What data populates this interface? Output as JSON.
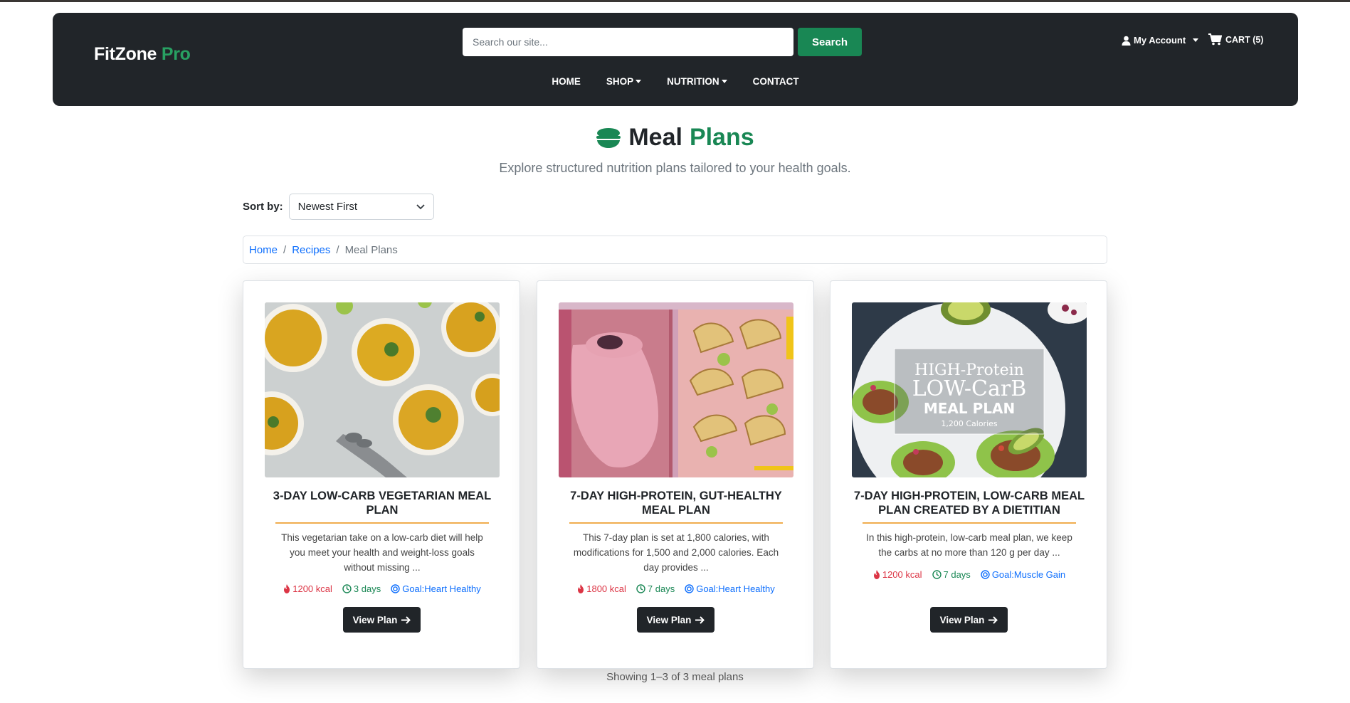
{
  "navbar": {
    "brand_main": "FitZone",
    "brand_accent": "Pro",
    "search_placeholder": "Search our site...",
    "search_button": "Search",
    "account_label": "My Account",
    "cart_label": "CART (5)",
    "menu": [
      {
        "label": "HOME",
        "dropdown": false
      },
      {
        "label": "SHOP",
        "dropdown": true
      },
      {
        "label": "NUTRITION",
        "dropdown": true
      },
      {
        "label": "CONTACT",
        "dropdown": false
      }
    ]
  },
  "header": {
    "icon": "bowl-icon",
    "title_main": "Meal",
    "title_accent": "Plans",
    "subtitle": "Explore structured nutrition plans tailored to your health goals."
  },
  "sort": {
    "label": "Sort by:",
    "selected": "Newest First"
  },
  "breadcrumb": {
    "items": [
      "Home",
      "Recipes"
    ],
    "current": "Meal Plans"
  },
  "cards": [
    {
      "title": "3-DAY LOW-CARB VEGETARIAN MEAL PLAN",
      "description": "This vegetarian take on a low-carb diet will help you meet your health and weight-loss goals without missing ...",
      "kcal": "1200 kcal",
      "days": "3 days",
      "goal": "Goal:Heart Healthy",
      "button": "View Plan"
    },
    {
      "title": "7-DAY HIGH-PROTEIN, GUT-HEALTHY MEAL PLAN",
      "description": "This 7-day plan is set at 1,800 calories, with modifications for 1,500 and 2,000 calories. Each day provides ...",
      "kcal": "1800 kcal",
      "days": "7 days",
      "goal": "Goal:Heart Healthy",
      "button": "View Plan"
    },
    {
      "title": "7-DAY HIGH-PROTEIN, LOW-CARB MEAL PLAN CREATED BY A DIETITIAN",
      "description": "In this high-protein, low-carb meal plan, we keep the carbs at no more than 120 g per day ...",
      "kcal": "1200 kcal",
      "days": "7 days",
      "goal": "Goal:Muscle Gain",
      "button": "View Plan",
      "image_text": {
        "line1": "HIGH-Protein",
        "line2": "LOW-CarB",
        "line3": "MEAL PLAN",
        "line4": "1,200 Calories"
      }
    }
  ],
  "footer": {
    "showing": "Showing 1–3 of 3 meal plans"
  },
  "colors": {
    "navbar_bg": "#212529",
    "accent_green": "#198754",
    "link_blue": "#0d6efd",
    "kcal_red": "#dc3545",
    "rule_orange": "#f0ad4e"
  }
}
